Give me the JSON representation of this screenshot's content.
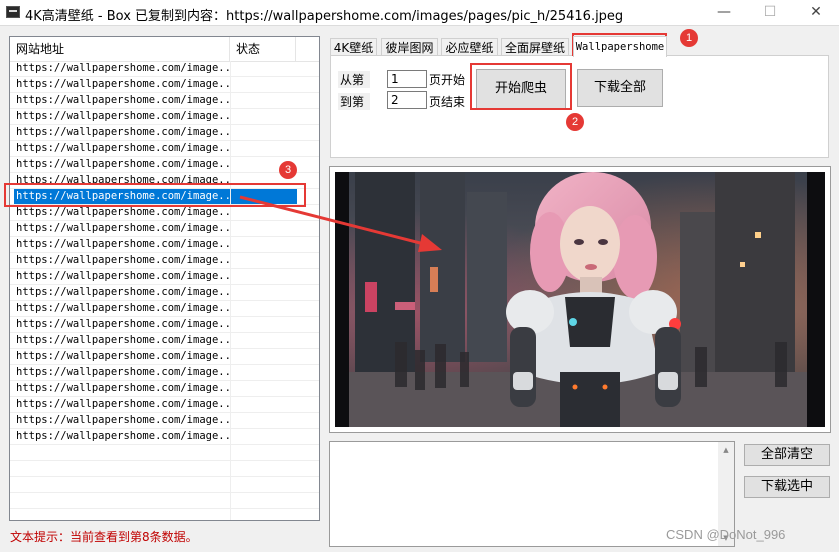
{
  "window": {
    "title": "4K高清壁纸 - Box   已复制到内容：https://wallpapershome.com/images/pages/pic_h/25416.jpeg",
    "icon": "app-icon",
    "minimize": "—",
    "maximize": "☐",
    "close": "✕"
  },
  "list": {
    "headers": {
      "url": "网站地址",
      "status": "状态"
    },
    "rows": [
      {
        "url": "https://wallpapershome.com/image...",
        "status": ""
      },
      {
        "url": "https://wallpapershome.com/image...",
        "status": ""
      },
      {
        "url": "https://wallpapershome.com/image...",
        "status": ""
      },
      {
        "url": "https://wallpapershome.com/image...",
        "status": ""
      },
      {
        "url": "https://wallpapershome.com/image...",
        "status": ""
      },
      {
        "url": "https://wallpapershome.com/image...",
        "status": ""
      },
      {
        "url": "https://wallpapershome.com/image...",
        "status": ""
      },
      {
        "url": "https://wallpapershome.com/image...",
        "status": ""
      },
      {
        "url": "https://wallpapershome.com/image...",
        "status": ""
      },
      {
        "url": "https://wallpapershome.com/image...",
        "status": ""
      },
      {
        "url": "https://wallpapershome.com/image...",
        "status": ""
      },
      {
        "url": "https://wallpapershome.com/image...",
        "status": ""
      },
      {
        "url": "https://wallpapershome.com/image...",
        "status": ""
      },
      {
        "url": "https://wallpapershome.com/image...",
        "status": ""
      },
      {
        "url": "https://wallpapershome.com/image...",
        "status": ""
      },
      {
        "url": "https://wallpapershome.com/image...",
        "status": ""
      },
      {
        "url": "https://wallpapershome.com/image...",
        "status": ""
      },
      {
        "url": "https://wallpapershome.com/image...",
        "status": ""
      },
      {
        "url": "https://wallpapershome.com/image...",
        "status": ""
      },
      {
        "url": "https://wallpapershome.com/image...",
        "status": ""
      },
      {
        "url": "https://wallpapershome.com/image...",
        "status": ""
      },
      {
        "url": "https://wallpapershome.com/image...",
        "status": ""
      },
      {
        "url": "https://wallpapershome.com/image...",
        "status": ""
      },
      {
        "url": "https://wallpapershome.com/image...",
        "status": ""
      },
      {
        "url": "",
        "status": ""
      },
      {
        "url": "",
        "status": ""
      },
      {
        "url": "",
        "status": ""
      },
      {
        "url": "",
        "status": ""
      },
      {
        "url": "",
        "status": ""
      }
    ],
    "selected_index": 8
  },
  "hint": "文本提示：当前查看到第8条数据。",
  "tabs": [
    "4K壁纸",
    "彼岸图网",
    "必应壁纸",
    "全面屏壁纸",
    "Wallpapershome"
  ],
  "active_tab": 4,
  "panel": {
    "from_label": "从第",
    "to_label": "到第",
    "start_page": "1",
    "end_page": "2",
    "page_start_label": "页开始",
    "page_end_label": "页结束",
    "start_crawl": "开始爬虫",
    "download_all": "下载全部"
  },
  "buttons": {
    "clear_all": "全部清空",
    "download_selected": "下载选中"
  },
  "badges": [
    "1",
    "2",
    "3"
  ],
  "watermark": "CSDN @DoNot_996",
  "colors": {
    "annotation": "#e53935",
    "selection": "#0078d7",
    "hint": "#c00000"
  }
}
